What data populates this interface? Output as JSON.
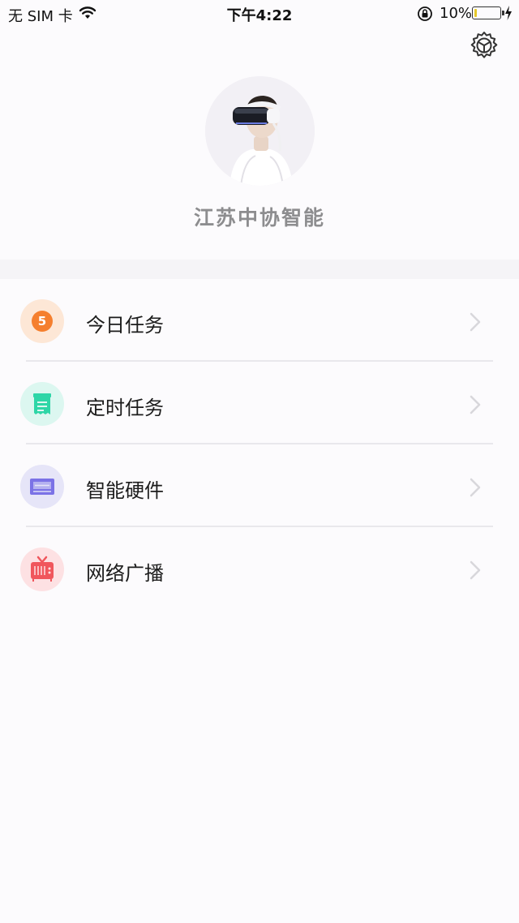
{
  "status_bar": {
    "carrier": "无 SIM 卡",
    "time": "下午4:22",
    "battery_percent": "10%",
    "battery_level": 0.1,
    "icons": [
      "wifi-icon",
      "rotation-lock-icon",
      "battery-icon",
      "charging-icon"
    ]
  },
  "header": {
    "settings_icon": "gear-icon",
    "company_name": "江苏中协智能"
  },
  "menu": {
    "items": [
      {
        "label": "今日任务",
        "icon": "today-task-icon",
        "badge": "5",
        "icon_bg": "#fde7d6",
        "icon_color": "#f57f2e"
      },
      {
        "label": "定时任务",
        "icon": "scheduled-task-icon",
        "icon_bg": "#dcf7f0",
        "icon_color": "#2ed6a7"
      },
      {
        "label": "智能硬件",
        "icon": "hardware-icon",
        "icon_bg": "#e6e5f8",
        "icon_color": "#7b72e6"
      },
      {
        "label": "网络广播",
        "icon": "broadcast-tv-icon",
        "icon_bg": "#fde1e3",
        "icon_color": "#f0565c"
      }
    ]
  }
}
